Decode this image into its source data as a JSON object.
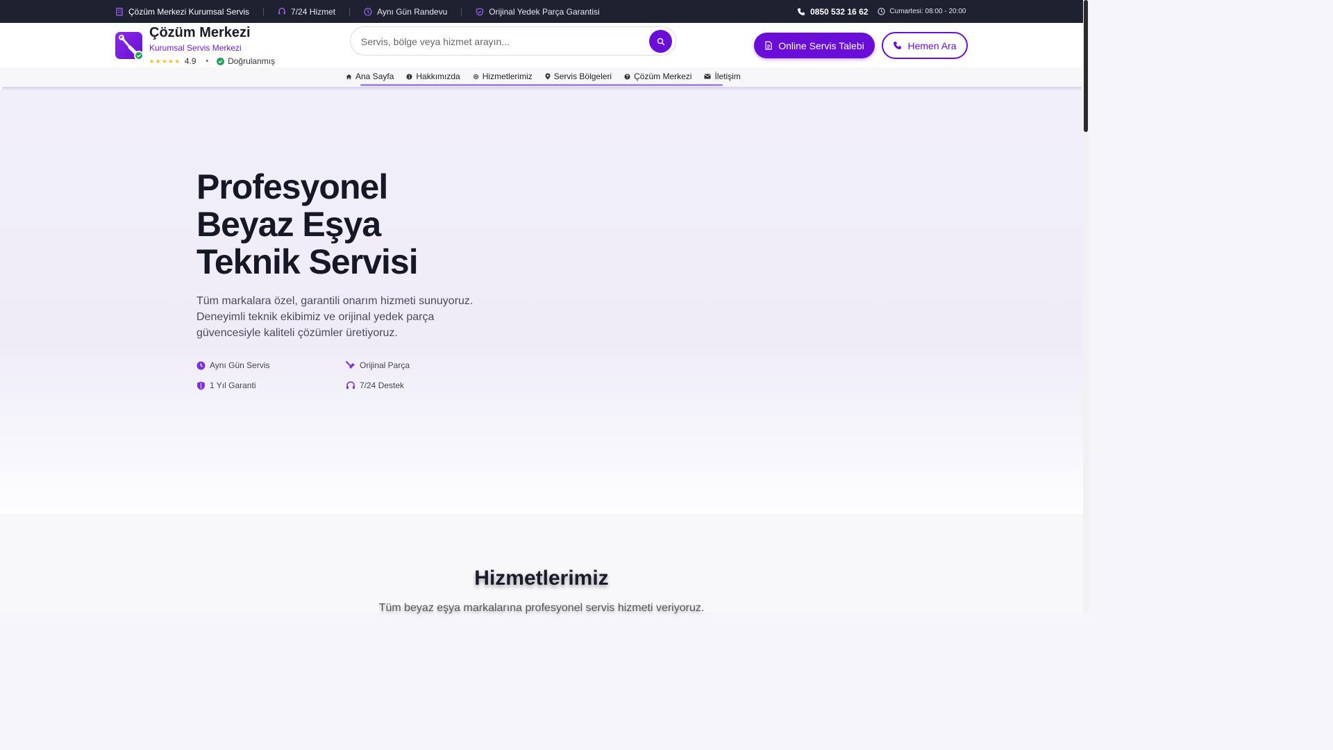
{
  "topbar": {
    "company": "Çözüm Merkezi Kurumsal Servis",
    "item1": "7/24 Hizmet",
    "item2": "Aynı Gün Randevu",
    "item3": "Orijinal Yedek Parça Garantisi",
    "phone": "0850 532 16 62",
    "hours": "Cumartesi: 08:00 - 20:00"
  },
  "header": {
    "brand_name": "Çözüm Merkezi",
    "brand_sub": "Kurumsal Servis Merkezi",
    "stars": "★★★★★",
    "rating": "4.9",
    "verified": "Doğrulanmış",
    "search_placeholder": "Servis, bölge veya hizmet arayın...",
    "cta_primary": "Online Servis Talebi",
    "cta_secondary": "Hemen Ara"
  },
  "nav": {
    "items": [
      {
        "label": "Ana Sayfa",
        "icon": "home-icon"
      },
      {
        "label": "Hakkımızda",
        "icon": "info-icon"
      },
      {
        "label": "Hizmetlerimiz",
        "icon": "gear-icon"
      },
      {
        "label": "Servis Bölgeleri",
        "icon": "map-pin-icon"
      },
      {
        "label": "Çözüm Merkezi",
        "icon": "question-icon"
      },
      {
        "label": "İletişim",
        "icon": "mail-icon"
      }
    ]
  },
  "hero": {
    "title_line1": "Profesyonel",
    "title_line2": "Beyaz Eşya",
    "title_line3": "Teknik Servisi",
    "description": "Tüm markalara özel, garantili onarım hizmeti sunuyoruz. Deneyimli teknik ekibimiz ve orijinal yedek parça güvencesiyle kaliteli çözümler üretiyoruz.",
    "features": [
      "Aynı Gün Servis",
      "Orijinal Parça",
      "1 Yıl Garanti",
      "7/24 Destek"
    ]
  },
  "services": {
    "title": "Hizmetlerimiz",
    "subtitle": "Tüm beyaz eşya markalarına profesyonel servis hizmeti veriyoruz."
  },
  "colors": {
    "accent": "#6a0dd6",
    "topbar_bg": "#1e2230",
    "verified": "#22a15c",
    "star": "#f4b400"
  }
}
